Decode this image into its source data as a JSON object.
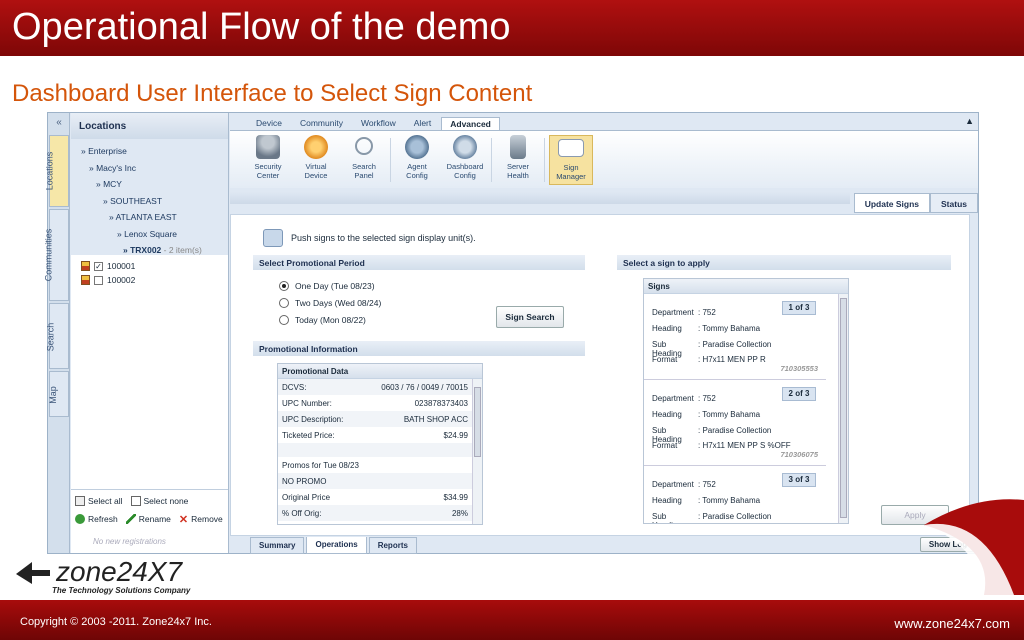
{
  "slide": {
    "title": "Operational Flow of the demo",
    "subtitle": "Dashboard User Interface to Select Sign Content",
    "copyright": "Copyright © 2003 -2011. Zone24x7 Inc.",
    "website": "www.zone24x7.com",
    "logo_text": "zone24X7",
    "logo_tagline": "The Technology Solutions Company"
  },
  "sidebar": {
    "collapse": "«",
    "vtabs": [
      "Locations",
      "Communities",
      "Search",
      "Map"
    ],
    "header": "Locations",
    "tree": [
      {
        "label": "» Enterprise",
        "indent": 0
      },
      {
        "label": "» Macy's Inc",
        "indent": 1
      },
      {
        "label": "» MCY",
        "indent": 2
      },
      {
        "label": "» SOUTHEAST",
        "indent": 3
      },
      {
        "label": "» ATLANTA EAST",
        "indent": 4
      },
      {
        "label": "» Lenox Square",
        "indent": 5
      }
    ],
    "selected_node": "» TRX002",
    "selected_count": " -  2 item(s)",
    "items": [
      {
        "label": "100001",
        "checked": true
      },
      {
        "label": "100002",
        "checked": false
      }
    ],
    "actions": {
      "select_all": "Select all",
      "select_none": "Select none",
      "refresh": "Refresh",
      "rename": "Rename",
      "remove": "Remove"
    },
    "no_registrations": "No new registrations"
  },
  "main": {
    "top_tabs": [
      "Device",
      "Community",
      "Workflow",
      "Alert",
      "Advanced"
    ],
    "active_top_tab": "Advanced",
    "collapse_arrow": "▲",
    "ribbon": [
      {
        "label1": "Security",
        "label2": "Center",
        "icon": "key-icon",
        "color": "#8a9aa8"
      },
      {
        "label1": "Virtual",
        "label2": "Device",
        "icon": "virtual-device-icon",
        "color": "#f0a030"
      },
      {
        "label1": "Search",
        "label2": "Panel",
        "icon": "magnifier-icon",
        "color": "#c8d4e0"
      },
      {
        "label1": "Agent",
        "label2": "Config",
        "icon": "agent-config-icon",
        "color": "#6a8fb0"
      },
      {
        "label1": "Dashboard",
        "label2": "Config",
        "icon": "dashboard-config-icon",
        "color": "#7a98b8"
      },
      {
        "label1": "Server",
        "label2": "Health",
        "icon": "server-health-icon",
        "color": "#98a8b8"
      },
      {
        "label1": "Sign",
        "label2": "Manager",
        "icon": "sign-manager-icon",
        "color": "#e8eef6"
      }
    ],
    "sub_tabs": [
      "Update Signs",
      "Status"
    ],
    "push_text": "Push signs to the selected sign display unit(s).",
    "promo_period": {
      "header": "Select Promotional Period",
      "options": [
        "One Day (Tue 08/23)",
        "Two Days (Wed 08/24)",
        "Today (Mon 08/22)"
      ],
      "selected": 0,
      "search_button": "Sign Search"
    },
    "promo_info": {
      "header": "Promotional Information",
      "grid_header": "Promotional Data",
      "rows": [
        {
          "k": "DCVS:",
          "v": "0603 / 76 / 0049 / 70015"
        },
        {
          "k": "UPC Number:",
          "v": "023878373403"
        },
        {
          "k": "UPC Description:",
          "v": "BATH SHOP ACC"
        },
        {
          "k": "Ticketed Price:",
          "v": "$24.99"
        },
        {
          "k": "",
          "v": ""
        },
        {
          "k": "Promos for Tue 08/23",
          "v": ""
        },
        {
          "k": "NO PROMO",
          "v": ""
        },
        {
          "k": "Original Price",
          "v": "$34.99"
        },
        {
          "k": "% Off Orig:",
          "v": "28%"
        }
      ]
    },
    "signs": {
      "header": "Select a sign to apply",
      "grid_header": "Signs",
      "cards": [
        {
          "badge": "1 of 3",
          "department": ": 752",
          "heading": ": Tommy Bahama",
          "subheading": ": Paradise Collection",
          "format": ": H7x11 MEN PP R",
          "code": "710305553"
        },
        {
          "badge": "2 of 3",
          "department": ": 752",
          "heading": ": Tommy Bahama",
          "subheading": ": Paradise Collection",
          "format": ": H7x11 MEN PP S %OFF",
          "code": "710306075"
        },
        {
          "badge": "3 of 3",
          "department": ": 752",
          "heading": ": Tommy Bahama",
          "subheading": ": Paradise Collection",
          "format": "",
          "code": ""
        }
      ],
      "labels": {
        "department": "Department",
        "heading": "Heading",
        "subheading": "Sub Heading",
        "format": "Format"
      },
      "apply_button": "Apply"
    },
    "bottom_tabs": [
      "Summary",
      "Operations",
      "Reports"
    ],
    "active_bottom_tab": "Operations",
    "show_log": "Show Log"
  }
}
